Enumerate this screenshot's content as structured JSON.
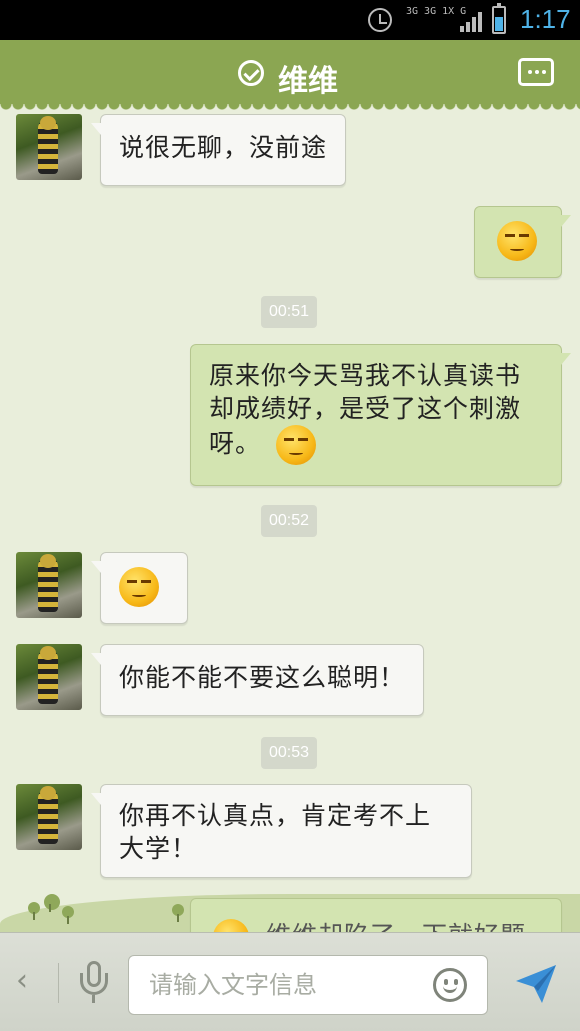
{
  "status_bar": {
    "network": "3G 3G 1X G",
    "time": "1:17"
  },
  "header": {
    "contact_name": "维维"
  },
  "messages": [
    {
      "side": "left",
      "type": "text",
      "text": "说很无聊，没前途"
    },
    {
      "side": "right",
      "type": "emoji",
      "emoji": "smirk-emoji"
    },
    {
      "type": "time",
      "text": "00:51"
    },
    {
      "side": "right",
      "type": "text",
      "lines": [
        "原来你今天骂我不认真读书",
        "却成绩好，是受了这个刺激",
        "呀。"
      ],
      "emoji": "chuckle-emoji"
    },
    {
      "type": "time",
      "text": "00:52"
    },
    {
      "side": "left",
      "type": "emoji",
      "emoji": "shy-smile-emoji"
    },
    {
      "side": "left",
      "type": "text",
      "text": "你能不能不要这么聪明！"
    },
    {
      "type": "time",
      "text": "00:53"
    },
    {
      "side": "left",
      "type": "text",
      "lines": [
        "你再不认真点，肯定考不上",
        "大学！"
      ]
    },
    {
      "side": "right",
      "type": "text",
      "text": "维维却陷了一下就好题发"
    }
  ],
  "input_bar": {
    "placeholder": "请输入文字信息",
    "back_glyph": "‹"
  },
  "colors": {
    "header": "#8ba652",
    "right_bubble": "#d3e4b1",
    "left_bubble": "#f7f7f4",
    "background": "#e9eedb"
  }
}
